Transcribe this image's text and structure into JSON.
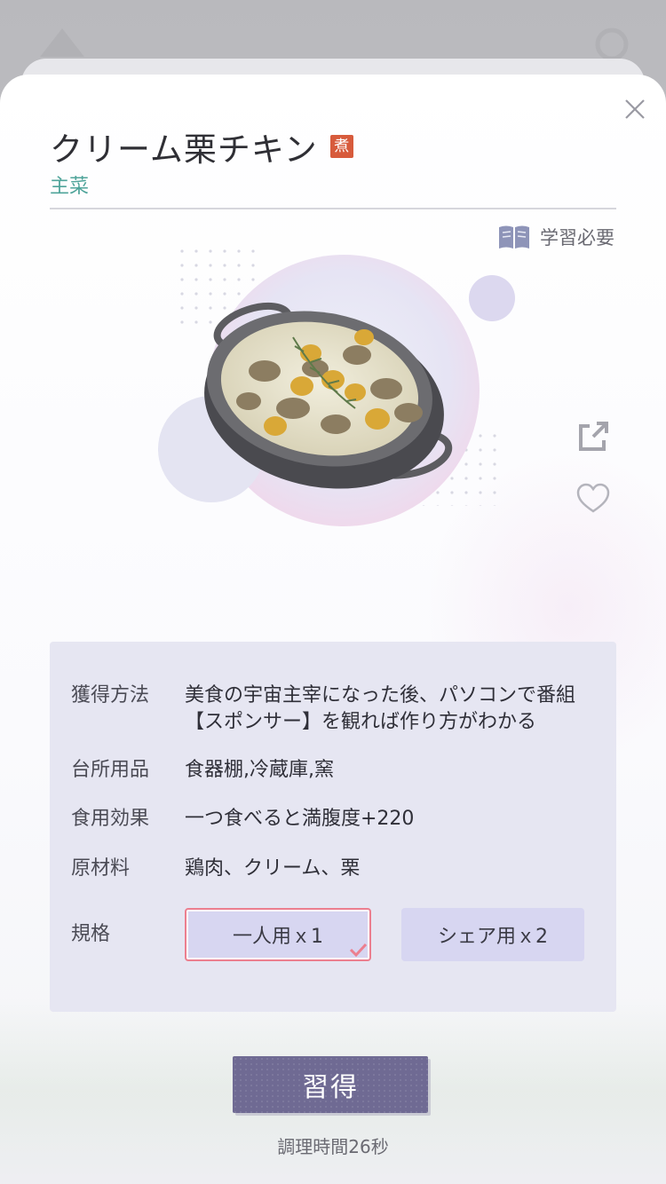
{
  "recipe": {
    "title": "クリーム栗チキン",
    "method_badge": "煮",
    "category": "主菜",
    "study_required": "学習必要"
  },
  "icons": {
    "close": "close-icon",
    "book": "book-icon",
    "share": "share-icon",
    "favorite": "heart-icon",
    "check": "check-icon"
  },
  "info": {
    "acquire": {
      "label": "獲得方法",
      "value": "美食の宇宙主宰になった後、パソコンで番組【スポンサー】を観れば作り方がわかる"
    },
    "kitchen": {
      "label": "台所用品",
      "value": "食器棚,冷蔵庫,窯"
    },
    "effect": {
      "label": "食用効果",
      "value": "一つ食べると満腹度+220"
    },
    "ingredients": {
      "label": "原材料",
      "value": "鶏肉、クリーム、栗"
    },
    "spec": {
      "label": "規格",
      "options": [
        {
          "label": "一人用ｘ1",
          "selected": true
        },
        {
          "label": "シェア用ｘ2",
          "selected": false
        }
      ]
    }
  },
  "actions": {
    "learn_label": "習得",
    "cook_time": "調理時間26秒"
  },
  "colors": {
    "category": "#4fa49a",
    "badge": "#d75b3c",
    "panel": "#e6e6f2",
    "primary_button": "#6f6a93",
    "selected_border": "#ec7f8f"
  }
}
